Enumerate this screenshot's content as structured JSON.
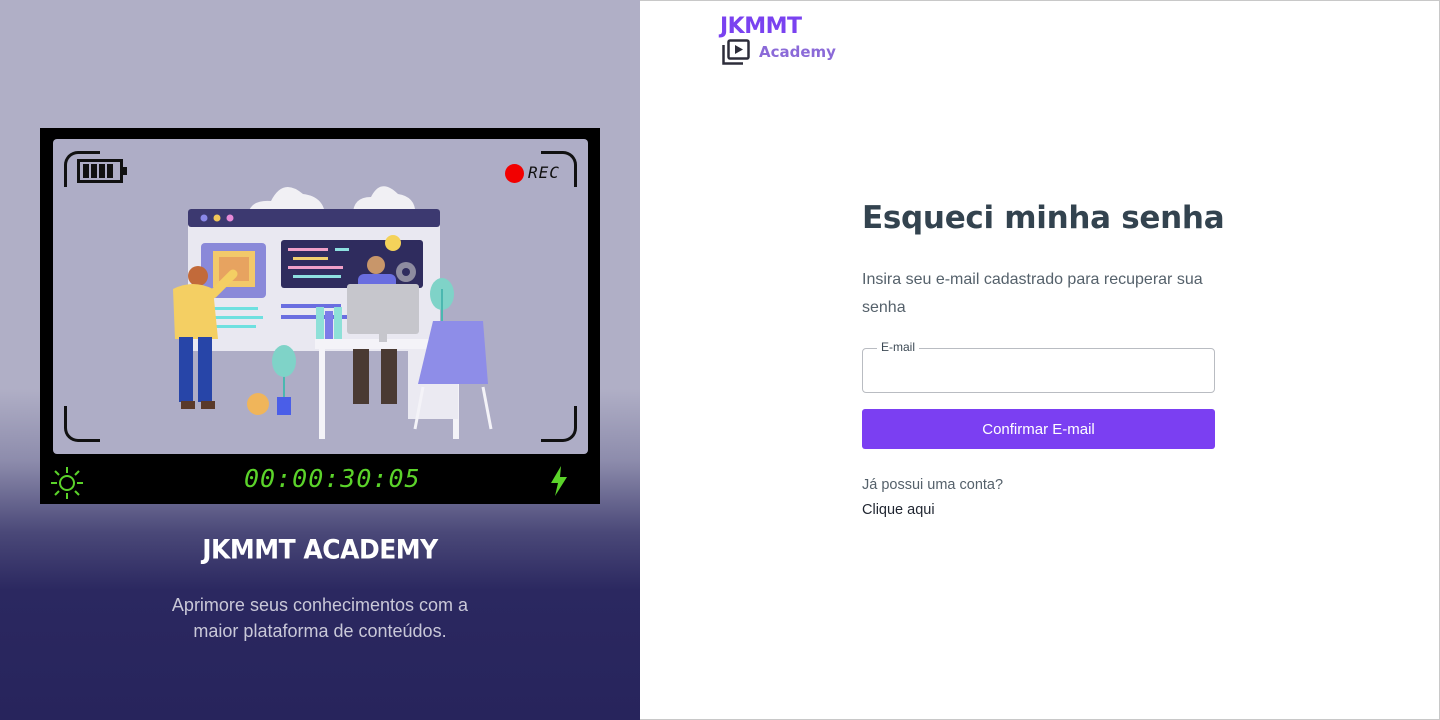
{
  "hero": {
    "camera": {
      "rec_label": "REC",
      "timer": "00:00:30:05"
    },
    "title": "JKMMT ACADEMY",
    "subtitle": "Aprimore seus conhecimentos com a maior plataforma de conteúdos."
  },
  "logo": {
    "name": "JKMMT",
    "sub": "Academy"
  },
  "form": {
    "title": "Esqueci minha senha",
    "description": "Insira seu e-mail cadastrado para recuperar sua senha",
    "email_label": "E-mail",
    "email_value": "",
    "email_placeholder": "",
    "submit_label": "Confirmar E-mail",
    "have_account": "Já possui uma conta?",
    "login_link": "Clique aqui"
  },
  "colors": {
    "accent": "#7b3ff2",
    "hero_dark": "#27245c",
    "hero_light": "#b0afc6",
    "title_text": "#33434f",
    "timer_green": "#5bd32a",
    "rec_red": "#f20000"
  },
  "icons": [
    "battery-icon",
    "rec-dot-icon",
    "brightness-icon",
    "flash-icon",
    "video-library-icon"
  ]
}
